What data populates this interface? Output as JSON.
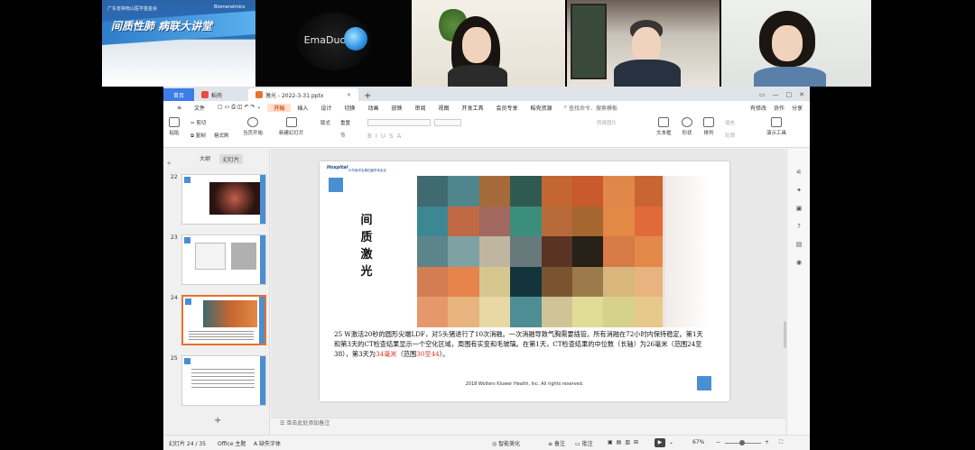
{
  "video_tiles": {
    "tile1": {
      "org_left": "广东省钟南山医学基金会",
      "org_right": "Biomeratmics",
      "org_right_sub": "健康中国",
      "slogan": "间质性肺 病联大讲堂"
    },
    "tile2": {
      "logo_text": "EmaDuoY"
    }
  },
  "window": {
    "tabs": [
      {
        "label": "首页"
      },
      {
        "label": "稻壳"
      },
      {
        "label": "激光 - 2022-3-31.pptx"
      }
    ],
    "new_tab": "+",
    "controls": {
      "restore": "▭",
      "minimize": "—",
      "maximize": "□",
      "close": "✕"
    }
  },
  "menu": {
    "file": "文件",
    "items": [
      "开始",
      "插入",
      "设计",
      "切换",
      "动画",
      "放映",
      "审阅",
      "视图",
      "开发工具",
      "会员专享",
      "稻壳资源"
    ],
    "search": "查找命令、搜索模板",
    "right": [
      "有修改",
      "协作",
      "分享"
    ]
  },
  "ribbon": {
    "paste": "粘贴",
    "cut": "剪切",
    "copy": "复制",
    "format_painter": "格式刷",
    "from_current": "当页开始",
    "new_slide": "新建幻灯片",
    "layout": "版式",
    "section": "节",
    "reset": "重置",
    "textbox": "文本框",
    "shape": "形状",
    "arrange": "排列",
    "outline": "轮廓",
    "presentation_tools": "演示工具",
    "convert_pic": "转换图片",
    "font_controls": [
      "B",
      "I",
      "U",
      "S",
      "A"
    ],
    "fill": "填充"
  },
  "left_pane": {
    "tab_outline": "大纲",
    "tab_slides": "幻灯片",
    "thumbs": [
      {
        "num": "22"
      },
      {
        "num": "23"
      },
      {
        "num": "24"
      },
      {
        "num": "25"
      }
    ],
    "add": "+",
    "collapse": "«"
  },
  "slide": {
    "logo": "Hospital",
    "logo_sub": "中华医学会第四届学术会议",
    "title": "间质激光",
    "caption_parts": [
      {
        "text": "25 W激活20秒的圆形尖端LDF，对5头猪进行了10次消融。一次消融导致气胸需要插管。所有消融在72小时内保持稳定。第1天和第3天的CT检查结果显示一个空化区域，周围有实变和毛玻璃。在第1天，CT检查结果的中位数（长轴）为26毫米（范围24至38），第3天为",
        "red": false
      },
      {
        "text": "34毫米",
        "red": true
      },
      {
        "text": "（范围",
        "red": false
      },
      {
        "text": "30至44",
        "red": true
      },
      {
        "text": "）。",
        "red": false
      }
    ],
    "copyright": "2018 Wolters Kluwer Health, Inc. All rights reserved.",
    "mosaic_colors": [
      "#3e6a70",
      "#4f868d",
      "#a56a3a",
      "#2f5a52",
      "#c4662f",
      "#c85a2e",
      "#e0874a",
      "#c86531",
      "#3b8794",
      "#c06a45",
      "#a0685e",
      "#3c8e7c",
      "#b86a3b",
      "#a5662f",
      "#e48846",
      "#e06a3a",
      "#5c858a",
      "#7ea1a4",
      "#bfb6a0",
      "#68797c",
      "#5a3323",
      "#262018",
      "#d87a45",
      "#e2894a",
      "#d57d52",
      "#e6844c",
      "#d6c790",
      "#12343a",
      "#7a5431",
      "#9c7a4a",
      "#d9b67b",
      "#e8b37e",
      "#e7986a",
      "#e7b480",
      "#e7d8a4",
      "#4e8d94",
      "#cfc496",
      "#e0dc98",
      "#d6d28e",
      "#e8c98c"
    ]
  },
  "notes": "单击此处添加备注",
  "status": {
    "slide_counter": "幻灯片 24 / 35",
    "theme": "Office 主题",
    "missing_fonts": "缺失字体",
    "beautify": "智能美化",
    "notes_btn": "备注",
    "comments_btn": "批注",
    "zoom": "67%"
  }
}
